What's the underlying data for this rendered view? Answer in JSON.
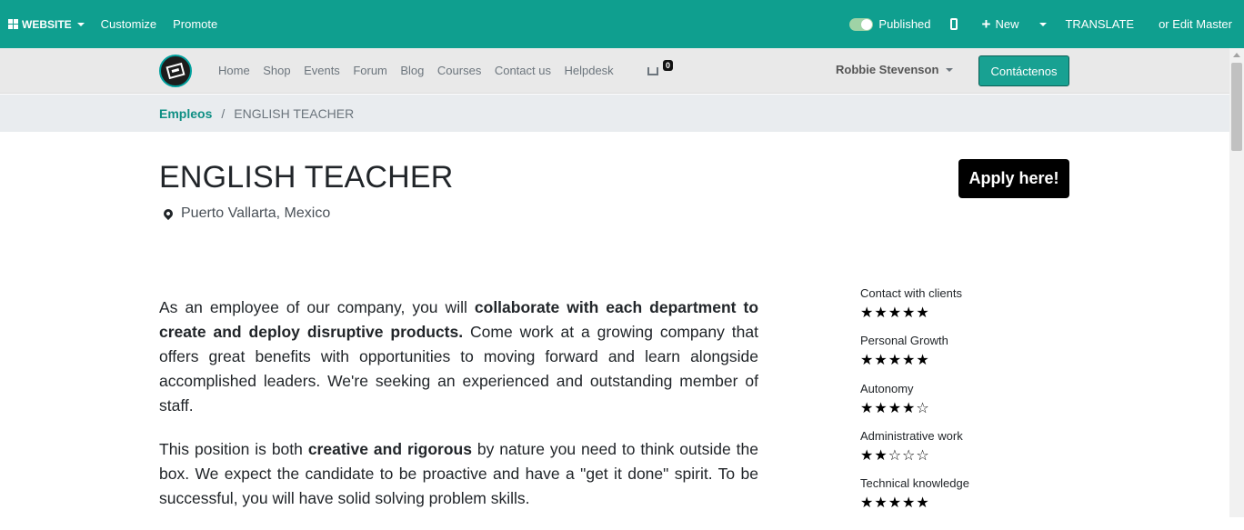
{
  "adminbar": {
    "website_label": "WEBSITE",
    "customize_label": "Customize",
    "promote_label": "Promote",
    "published_label": "Published",
    "new_label": "New",
    "translate_label": "TRANSLATE",
    "edit_master_label": "or Edit Master",
    "bg_color": "#0f9f8f"
  },
  "nav": {
    "links": [
      "Home",
      "Shop",
      "Events",
      "Forum",
      "Blog",
      "Courses",
      "Contact us",
      "Helpdesk"
    ],
    "cart_count": "0",
    "user_name": "Robbie Stevenson",
    "contact_button": "Contáctenos"
  },
  "breadcrumb": {
    "parent": "Empleos",
    "separator": "/",
    "current": "ENGLISH TEACHER"
  },
  "job": {
    "title": "ENGLISH TEACHER",
    "location": "Puerto Vallarta, Mexico",
    "apply_label": "Apply here!",
    "p1_a": "As an employee of our company, you will ",
    "p1_b": "collaborate with each department to create and deploy disruptive products.",
    "p1_c": " Come work at a growing company that offers great benefits with opportunities to moving forward and learn alongside accomplished leaders. We're seeking an experienced and outstanding member of staff.",
    "p2_a": "This position is both ",
    "p2_b": "creative and rigorous",
    "p2_c": " by nature you need to think outside the box. We expect the candidate to be proactive and have a \"get it done\" spirit. To be successful, you will have solid solving problem skills."
  },
  "skills": [
    {
      "name": "Contact with clients",
      "rating": 5,
      "max": 5
    },
    {
      "name": "Personal Growth",
      "rating": 5,
      "max": 5
    },
    {
      "name": "Autonomy",
      "rating": 4,
      "max": 5
    },
    {
      "name": "Administrative work",
      "rating": 2,
      "max": 5
    },
    {
      "name": "Technical knowledge",
      "rating": 5,
      "max": 5
    }
  ]
}
